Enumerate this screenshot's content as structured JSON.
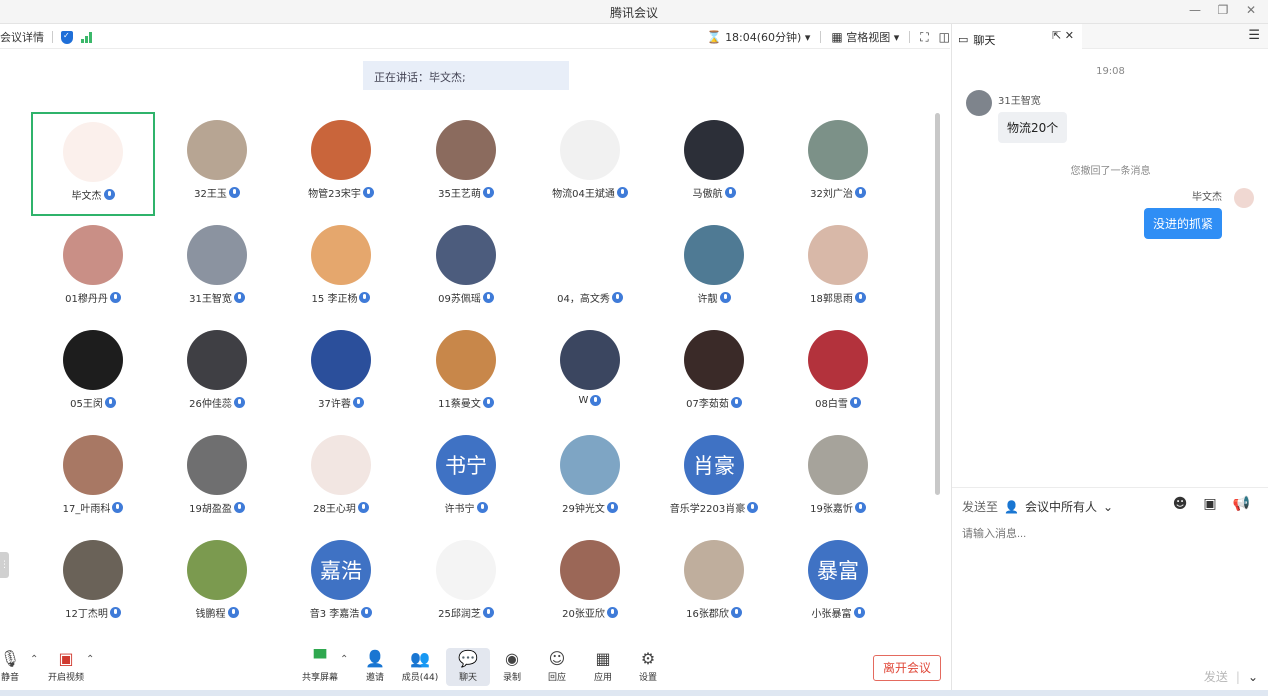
{
  "window": {
    "title": "腾讯会议"
  },
  "toolbar": {
    "meeting_details": "会议详情",
    "timer": "18:04(60分钟)",
    "view_mode": "宫格视图"
  },
  "speaker_banner": "正在讲话：毕文杰;",
  "participants": [
    {
      "name": "毕文杰",
      "color": "#fbf0ec",
      "active": true
    },
    {
      "name": "32王玉",
      "color": "#b7a593"
    },
    {
      "name": "物管23宋宇",
      "color": "#c9653b"
    },
    {
      "name": "35王艺萌",
      "color": "#8b6b5e"
    },
    {
      "name": "物流04王斌通",
      "color": "#f1f1f1"
    },
    {
      "name": "马傲航",
      "color": "#2c2f38"
    },
    {
      "name": "32刘广治",
      "color": "#7c9188"
    },
    {
      "name": "01穆丹丹",
      "color": "#c98f86"
    },
    {
      "name": "31王智宽",
      "color": "#8b93a0"
    },
    {
      "name": "15 李正杨",
      "color": "#e5a76d"
    },
    {
      "name": "09苏佩瑶",
      "color": "#4c5c7d"
    },
    {
      "name": "04，高文秀",
      "color": "#ffffff"
    },
    {
      "name": "许靓",
      "color": "#4f7a94"
    },
    {
      "name": "18郭思雨",
      "color": "#d8b8a8"
    },
    {
      "name": "05王闵",
      "color": "#1d1d1d"
    },
    {
      "name": "26仲佳蕊",
      "color": "#3f3f44"
    },
    {
      "name": "37许蓉",
      "color": "#2b4f9b"
    },
    {
      "name": "11蔡曼文",
      "color": "#c8874a"
    },
    {
      "name": "W",
      "color": "#3b4660"
    },
    {
      "name": "07李茹茹",
      "color": "#3a2a28"
    },
    {
      "name": "08白雪",
      "color": "#b3323c"
    },
    {
      "name": "17_叶雨科",
      "color": "#a87864"
    },
    {
      "name": "19胡盈盈",
      "color": "#6f6f70"
    },
    {
      "name": "28王心玥",
      "color": "#f2e6e2"
    },
    {
      "name": "许书宁",
      "color": "#3f72c4",
      "text": "书宁"
    },
    {
      "name": "29钟光文",
      "color": "#7ea5c4"
    },
    {
      "name": "音乐学2203肖豪",
      "color": "#3f72c4",
      "text": "肖豪"
    },
    {
      "name": "19张嘉忻",
      "color": "#a6a39b"
    },
    {
      "name": "12丁杰明",
      "color": "#6a6258"
    },
    {
      "name": "钱鹏程",
      "color": "#7b9a4f"
    },
    {
      "name": "音3 李嘉浩",
      "color": "#3f72c4",
      "text": "嘉浩"
    },
    {
      "name": "25邱润芝",
      "color": "#f4f4f4"
    },
    {
      "name": "20张亚欣",
      "color": "#9b6757"
    },
    {
      "name": "16张郡欣",
      "color": "#bfae9d"
    },
    {
      "name": "小张暴富",
      "color": "#3f72c4",
      "text": "暴富"
    }
  ],
  "bottombar": {
    "mute": "静音",
    "video": "开启视频",
    "share": "共享屏幕",
    "invite": "邀请",
    "members": "成员(44)",
    "chat": "聊天",
    "record": "录制",
    "reaction": "回应",
    "apps": "应用",
    "settings": "设置",
    "leave": "离开会议"
  },
  "chat": {
    "tab": "聊天",
    "time": "19:08",
    "msg1_sender": "31王智宽",
    "msg1_text": "物流20个",
    "system": "您撤回了一条消息",
    "msg2_sender": "毕文杰",
    "msg2_text": "没进的抓紧",
    "send_to_label": "发送至",
    "send_to_value": "会议中所有人",
    "input_placeholder": "请输入消息...",
    "send": "发送"
  }
}
